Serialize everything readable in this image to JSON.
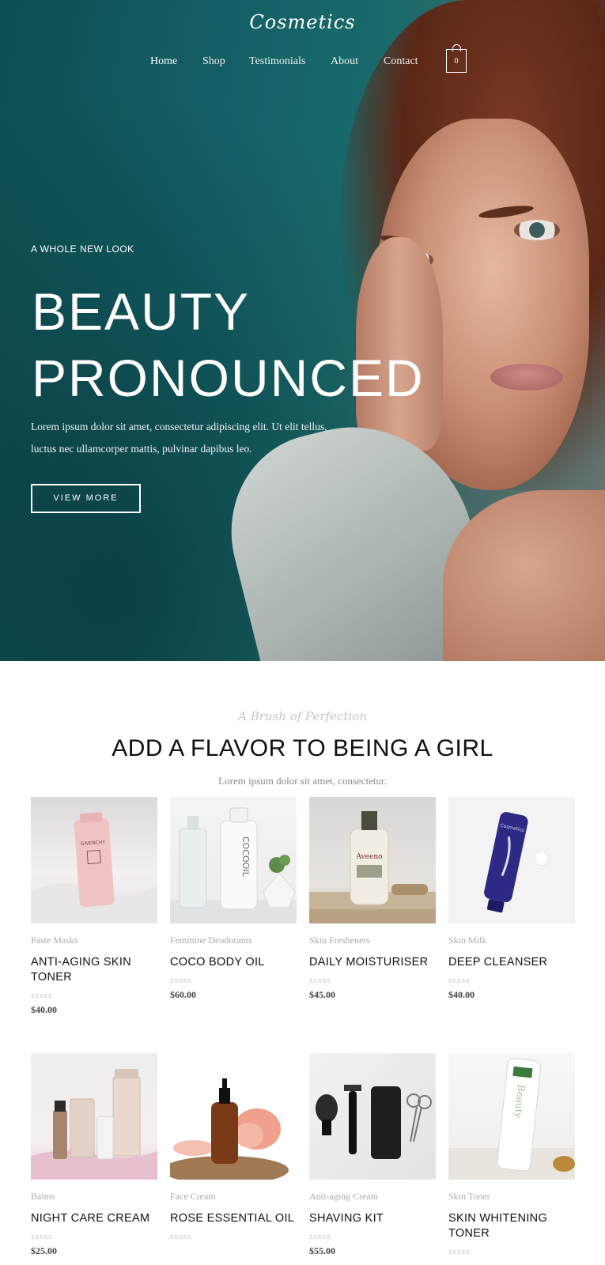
{
  "brand": {
    "logo": "Cosmetics"
  },
  "nav": {
    "items": [
      "Home",
      "Shop",
      "Testimonials",
      "About",
      "Contact"
    ],
    "cart_count": "0"
  },
  "hero": {
    "tagline": "A WHOLE NEW LOOK",
    "title_line1": "BEAUTY",
    "title_line2": "PRONOUNCED",
    "text_line1": "Lorem ipsum dolor sit amet, consectetur adipiscing elit. Ut elit tellus,",
    "text_line2": "luctus nec ullamcorper mattis, pulvinar dapibus leo.",
    "button": "VIEW MORE"
  },
  "section": {
    "script": "A Brush of Perfection",
    "title": "ADD A FLAVOR TO BEING A GIRL",
    "subtitle": "Lorem ipsum dolor sit amet, consectetur."
  },
  "products": [
    {
      "category": "Paste Masks",
      "name": "ANTI-AGING SKIN TONER",
      "rating": "sssss",
      "price": "$40.00"
    },
    {
      "category": "Feminine Deodorants",
      "name": "COCO BODY OIL",
      "rating": "sssss",
      "price": "$60.00"
    },
    {
      "category": "Skin Fresheners",
      "name": "DAILY MOISTURISER",
      "rating": "sssss",
      "price": "$45.00"
    },
    {
      "category": "Skin Milk",
      "name": "DEEP CLEANSER",
      "rating": "sssss",
      "price": "$40.00"
    },
    {
      "category": "Balms",
      "name": "NIGHT CARE CREAM",
      "rating": "sssss",
      "price": "$25.00"
    },
    {
      "category": "Face Cream",
      "name": "ROSE ESSENTIAL OIL",
      "rating": "sssss",
      "price": ""
    },
    {
      "category": "Anti-aging Cream",
      "name": "SHAVING KIT",
      "rating": "sssss",
      "price": "$55.00"
    },
    {
      "category": "Skin Toner",
      "name": "SKIN WHITENING TONER",
      "rating": "sssss",
      "price": ""
    }
  ],
  "product_images": {
    "p1": {
      "label": "GIVENCHY"
    },
    "p2": {
      "label": "COCOOIL"
    },
    "p3": {
      "label": "Aveeno"
    },
    "p4": {
      "label": "Cosmetics"
    },
    "p8": {
      "label": "Beauty"
    }
  }
}
